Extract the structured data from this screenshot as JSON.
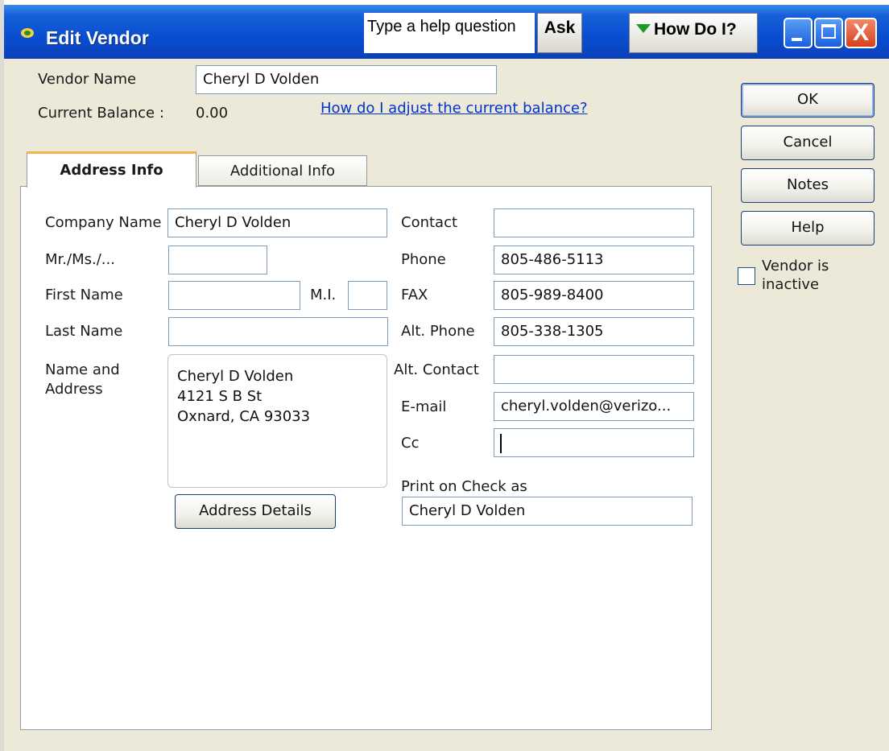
{
  "window": {
    "title": "Edit Vendor",
    "help_placeholder": "Type a help question",
    "ask_label": "Ask",
    "how_do_i_label": "How Do I?",
    "close_glyph": "X"
  },
  "header": {
    "vendor_name_label": "Vendor Name",
    "vendor_name_value": "Cheryl D Volden",
    "current_balance_label": "Current Balance :",
    "current_balance_value": "0.00",
    "adjust_balance_link": "How do I adjust the current balance?"
  },
  "tabs": [
    {
      "label": "Address Info",
      "active": true
    },
    {
      "label": "Additional Info",
      "active": false
    }
  ],
  "address_info": {
    "company_name_label": "Company Name",
    "company_name_value": "Cheryl D Volden",
    "salutation_label": "Mr./Ms./...",
    "salutation_value": "",
    "first_name_label": "First Name",
    "first_name_value": "",
    "mi_label": "M.I.",
    "mi_value": "",
    "last_name_label": "Last Name",
    "last_name_value": "",
    "name_address_label_line1": "Name and",
    "name_address_label_line2": "Address",
    "address_lines": [
      "Cheryl D Volden",
      "4121 S B St",
      "Oxnard, CA 93033"
    ],
    "address_details_button": "Address Details",
    "contact_label": "Contact",
    "contact_value": "",
    "phone_label": "Phone",
    "phone_value": "805-486-5113",
    "fax_label": "FAX",
    "fax_value": "805-989-8400",
    "alt_phone_label": "Alt. Phone",
    "alt_phone_value": "805-338-1305",
    "alt_contact_label": "Alt. Contact",
    "alt_contact_value": "",
    "email_label": "E-mail",
    "email_value": "cheryl.volden@verizo...",
    "cc_label": "Cc",
    "cc_value": "",
    "print_on_check_label": "Print on Check as",
    "print_on_check_value": "Cheryl D Volden"
  },
  "side_buttons": {
    "ok": "OK",
    "cancel": "Cancel",
    "notes": "Notes",
    "help": "Help",
    "inactive_line1": "Vendor is",
    "inactive_line2": "inactive"
  }
}
